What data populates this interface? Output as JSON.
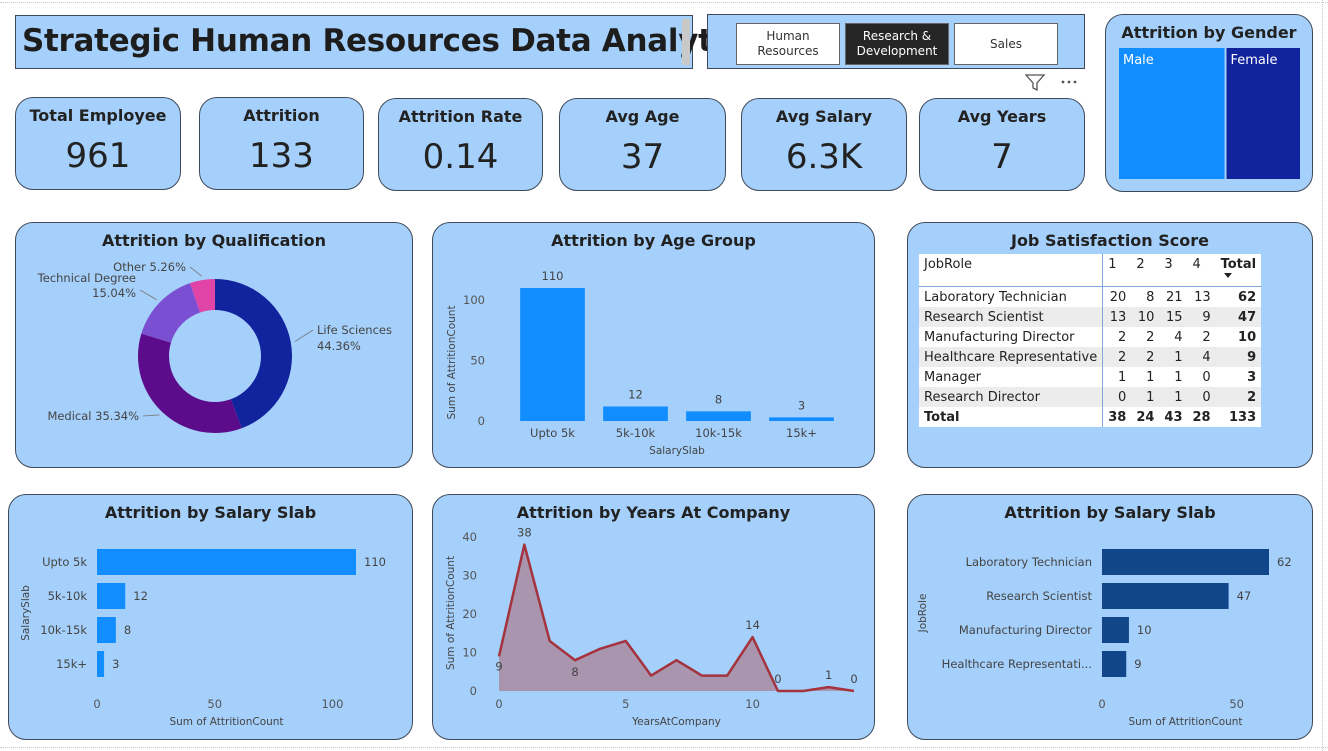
{
  "header": {
    "title": "Strategic Human Resources Data Analytics",
    "department_slicer": [
      {
        "label": "Human Resources",
        "selected": false
      },
      {
        "label": "Research & Development",
        "selected": true
      },
      {
        "label": "Sales",
        "selected": false
      }
    ]
  },
  "kpis": [
    {
      "label": "Total Employee",
      "value": "961"
    },
    {
      "label": "Attrition",
      "value": "133"
    },
    {
      "label": "Attrition Rate",
      "value": "0.14"
    },
    {
      "label": "Avg Age",
      "value": "37"
    },
    {
      "label": "Avg Salary",
      "value": "6.3K"
    },
    {
      "label": "Avg Years",
      "value": "7"
    }
  ],
  "colors": {
    "card_bg": "#a5d0fb",
    "bar_blue": "#118dff",
    "bar_navy": "#12468a",
    "gender_male": "#118dff",
    "gender_female": "#12239e",
    "donut": [
      "#12239e",
      "#5c0b8a",
      "#7b4fd1",
      "#e044a7"
    ],
    "area_line": "#a4333d",
    "area_fill": "#a98ca0"
  },
  "chart_data": [
    {
      "id": "gender",
      "type": "treemap",
      "title": "Attrition by Gender",
      "categories": [
        "Male",
        "Female"
      ],
      "values": [
        79,
        54
      ]
    },
    {
      "id": "qualification",
      "type": "pie",
      "title": "Attrition by Qualification",
      "categories": [
        "Life Sciences",
        "Medical",
        "Technical Degree",
        "Other"
      ],
      "values": [
        44.36,
        35.34,
        15.04,
        5.26
      ],
      "labels": [
        "Life Sciences 44.36%",
        "Medical 35.34%",
        "Technical Degree 15.04%",
        "Other 5.26%"
      ]
    },
    {
      "id": "age_group",
      "type": "bar",
      "title": "Attrition by Age Group",
      "xlabel": "SalarySlab",
      "ylabel": "Sum of AttritionCount",
      "categories": [
        "Upto 5k",
        "5k-10k",
        "10k-15k",
        "15k+"
      ],
      "values": [
        110,
        12,
        8,
        3
      ],
      "yticks": [
        0,
        50,
        100
      ],
      "ylim": [
        0,
        110
      ]
    },
    {
      "id": "salary_slab",
      "type": "bar",
      "orientation": "horizontal",
      "title": "Attrition by Salary Slab",
      "xlabel": "Sum of AttritionCount",
      "ylabel": "SalarySlab",
      "categories": [
        "Upto 5k",
        "5k-10k",
        "10k-15k",
        "15k+"
      ],
      "values": [
        110,
        12,
        8,
        3
      ],
      "xticks": [
        0,
        50,
        100
      ],
      "xlim": [
        0,
        110
      ]
    },
    {
      "id": "years_at_company",
      "type": "area",
      "title": "Attrition by Years At Company",
      "xlabel": "YearsAtCompany",
      "ylabel": "Sum of AttritionCount",
      "x": [
        0,
        1,
        2,
        3,
        4,
        5,
        6,
        7,
        8,
        9,
        10,
        11,
        12,
        13,
        14
      ],
      "y": [
        9,
        38,
        13,
        8,
        11,
        13,
        4,
        8,
        4,
        4,
        14,
        0,
        0,
        1,
        0
      ],
      "data_labels": [
        {
          "x": 0,
          "text": "9"
        },
        {
          "x": 1,
          "text": "38"
        },
        {
          "x": 3,
          "text": "8"
        },
        {
          "x": 10,
          "text": "14"
        },
        {
          "x": 11,
          "text": "0"
        },
        {
          "x": 13,
          "text": "1"
        },
        {
          "x": 14,
          "text": "0"
        }
      ],
      "xticks": [
        0,
        5,
        10
      ],
      "yticks": [
        0,
        10,
        20,
        30,
        40
      ],
      "ylim": [
        0,
        40
      ]
    },
    {
      "id": "salary_slab_jobrole",
      "type": "bar",
      "orientation": "horizontal",
      "title": "Attrition by Salary Slab",
      "xlabel": "Sum of AttritionCount",
      "ylabel": "JobRole",
      "categories": [
        "Laboratory Technician",
        "Research Scientist",
        "Manufacturing Director",
        "Healthcare Representati..."
      ],
      "values": [
        62,
        47,
        10,
        9
      ],
      "xticks": [
        0,
        50
      ],
      "xlim": [
        0,
        62
      ]
    },
    {
      "id": "job_satisfaction",
      "type": "table",
      "title": "Job Satisfaction Score",
      "columns": [
        "JobRole",
        "1",
        "2",
        "3",
        "4",
        "Total"
      ],
      "rows": [
        [
          "Laboratory Technician",
          "20",
          "8",
          "21",
          "13",
          "62"
        ],
        [
          "Research Scientist",
          "13",
          "10",
          "15",
          "9",
          "47"
        ],
        [
          "Manufacturing Director",
          "2",
          "2",
          "4",
          "2",
          "10"
        ],
        [
          "Healthcare Representative",
          "2",
          "2",
          "1",
          "4",
          "9"
        ],
        [
          "Manager",
          "1",
          "1",
          "1",
          "0",
          "3"
        ],
        [
          "Research Director",
          "0",
          "1",
          "1",
          "0",
          "2"
        ]
      ],
      "total_row": [
        "Total",
        "38",
        "24",
        "43",
        "28",
        "133"
      ]
    }
  ]
}
